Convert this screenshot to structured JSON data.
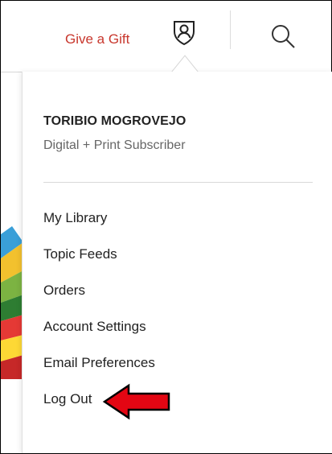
{
  "header": {
    "gift_label": "Give a Gift",
    "account_icon": "shield-person-icon",
    "search_icon": "search-icon"
  },
  "account_menu": {
    "user_name": "TORIBIO MOGROVEJO",
    "subscription": "Digital + Print Subscriber",
    "items": [
      {
        "label": "My Library"
      },
      {
        "label": "Topic Feeds"
      },
      {
        "label": "Orders"
      },
      {
        "label": "Account Settings"
      },
      {
        "label": "Email Preferences"
      },
      {
        "label": "Log Out"
      }
    ]
  },
  "annotation": {
    "arrow_color": "#e30613",
    "points_to": "Log Out"
  },
  "colors": {
    "accent": "#c8372d",
    "text": "#222222",
    "muted": "#666666"
  }
}
